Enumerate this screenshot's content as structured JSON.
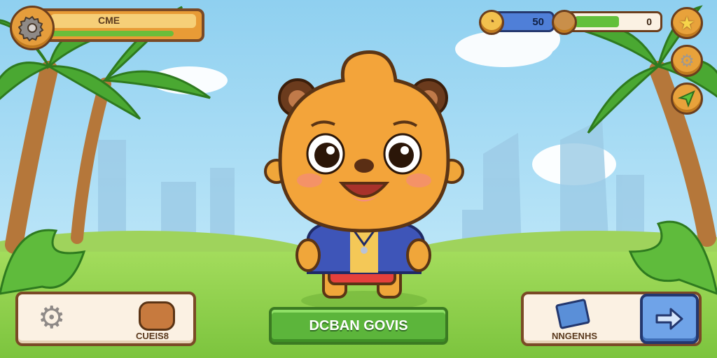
{
  "top_left": {
    "title": "CME"
  },
  "top_right": {
    "coins": "50",
    "progress_value": "0",
    "progress_fraction": 0.55
  },
  "bottom_left": {
    "label": "CUEIS8"
  },
  "center_button": {
    "label": "DCBAN GOVIS"
  },
  "bottom_right": {
    "label": "NNGENHS"
  },
  "icons": {
    "settings": "gear-icon",
    "star": "star-icon",
    "send": "paper-plane-icon",
    "forward": "arrow-right-icon",
    "coin": "coin-icon"
  },
  "colors": {
    "sky": "#a9dcf3",
    "grass": "#8fd14f",
    "panel": "#fbf1e3",
    "accent_green": "#5cb53b",
    "accent_orange": "#e8a23b",
    "progress_blue": "#4f7fd8"
  }
}
